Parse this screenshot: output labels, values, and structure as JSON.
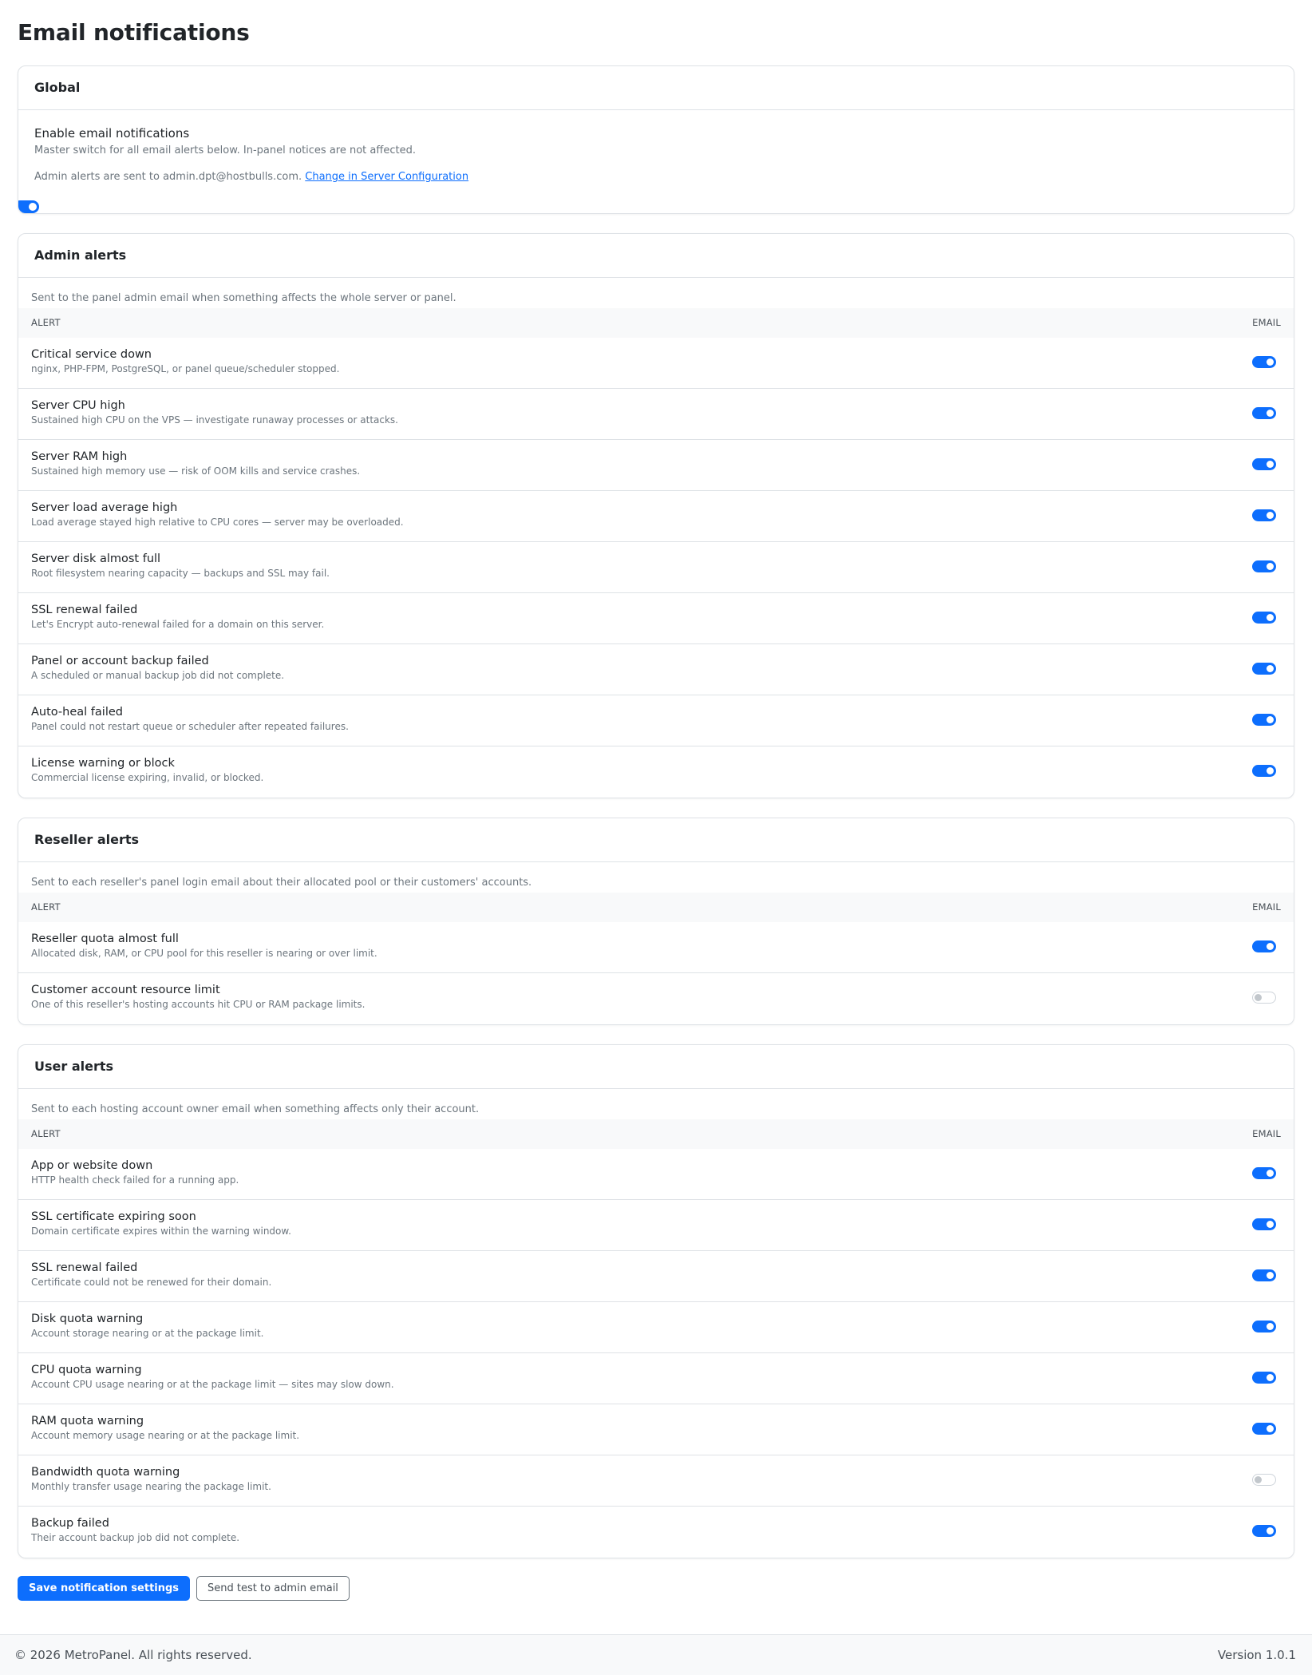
{
  "page": {
    "title": "Email notifications"
  },
  "global": {
    "header": "Global",
    "enable_title": "Enable email notifications",
    "enable_desc": "Master switch for all email alerts below. In-panel notices are not affected.",
    "enabled": true,
    "note_prefix": "Admin alerts are sent to admin.dpt@hostbulls.com.",
    "note_link": "Change in Server Configuration"
  },
  "admin": {
    "header": "Admin alerts",
    "desc": "Sent to the panel admin email when something affects the whole server or panel.",
    "col_alert": "ALERT",
    "col_email": "EMAIL",
    "rows": [
      {
        "title": "Critical service down",
        "desc": "nginx, PHP-FPM, PostgreSQL, or panel queue/scheduler stopped.",
        "on": true
      },
      {
        "title": "Server CPU high",
        "desc": "Sustained high CPU on the VPS — investigate runaway processes or attacks.",
        "on": true
      },
      {
        "title": "Server RAM high",
        "desc": "Sustained high memory use — risk of OOM kills and service crashes.",
        "on": true
      },
      {
        "title": "Server load average high",
        "desc": "Load average stayed high relative to CPU cores — server may be overloaded.",
        "on": true
      },
      {
        "title": "Server disk almost full",
        "desc": "Root filesystem nearing capacity — backups and SSL may fail.",
        "on": true
      },
      {
        "title": "SSL renewal failed",
        "desc": "Let's Encrypt auto-renewal failed for a domain on this server.",
        "on": true
      },
      {
        "title": "Panel or account backup failed",
        "desc": "A scheduled or manual backup job did not complete.",
        "on": true
      },
      {
        "title": "Auto-heal failed",
        "desc": "Panel could not restart queue or scheduler after repeated failures.",
        "on": true
      },
      {
        "title": "License warning or block",
        "desc": "Commercial license expiring, invalid, or blocked.",
        "on": true
      }
    ]
  },
  "reseller": {
    "header": "Reseller alerts",
    "desc": "Sent to each reseller's panel login email about their allocated pool or their customers' accounts.",
    "col_alert": "ALERT",
    "col_email": "EMAIL",
    "rows": [
      {
        "title": "Reseller quota almost full",
        "desc": "Allocated disk, RAM, or CPU pool for this reseller is nearing or over limit.",
        "on": true
      },
      {
        "title": "Customer account resource limit",
        "desc": "One of this reseller's hosting accounts hit CPU or RAM package limits.",
        "on": false
      }
    ]
  },
  "user": {
    "header": "User alerts",
    "desc": "Sent to each hosting account owner email when something affects only their account.",
    "col_alert": "ALERT",
    "col_email": "EMAIL",
    "rows": [
      {
        "title": "App or website down",
        "desc": "HTTP health check failed for a running app.",
        "on": true
      },
      {
        "title": "SSL certificate expiring soon",
        "desc": "Domain certificate expires within the warning window.",
        "on": true
      },
      {
        "title": "SSL renewal failed",
        "desc": "Certificate could not be renewed for their domain.",
        "on": true
      },
      {
        "title": "Disk quota warning",
        "desc": "Account storage nearing or at the package limit.",
        "on": true
      },
      {
        "title": "CPU quota warning",
        "desc": "Account CPU usage nearing or at the package limit — sites may slow down.",
        "on": true
      },
      {
        "title": "RAM quota warning",
        "desc": "Account memory usage nearing or at the package limit.",
        "on": true
      },
      {
        "title": "Bandwidth quota warning",
        "desc": "Monthly transfer usage nearing the package limit.",
        "on": false
      },
      {
        "title": "Backup failed",
        "desc": "Their account backup job did not complete.",
        "on": true
      }
    ]
  },
  "actions": {
    "save_label": "Save notification settings",
    "test_label": "Send test to admin email"
  },
  "footer": {
    "copyright": "© 2026 MetroPanel. All rights reserved.",
    "version": "Version 1.0.1"
  },
  "colors": {
    "accent": "#0d6efd",
    "border": "#dee2e6",
    "muted_text": "#6c757d"
  }
}
